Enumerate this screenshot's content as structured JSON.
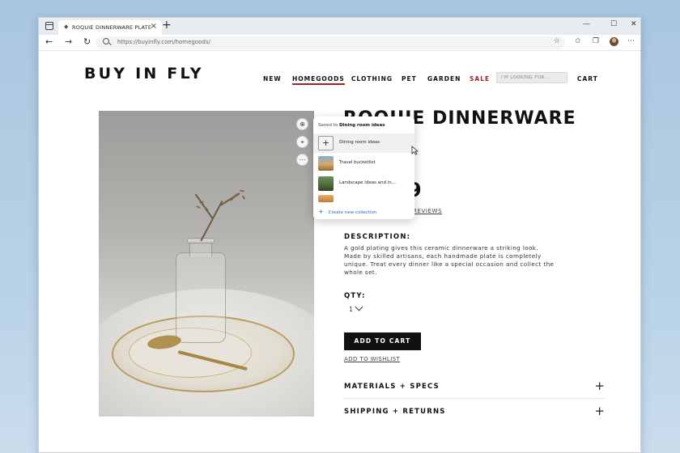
{
  "browser": {
    "tab_title": "ROQUIE DINNERWARE  PLATE",
    "url": "https://buyinfly.com/homegoods/",
    "window_controls": [
      "—",
      "☐",
      "✕"
    ]
  },
  "site": {
    "logo": "BUY IN FLY",
    "nav": [
      "NEW",
      "HOMEGOODS",
      "CLOTHING",
      "PET",
      "GARDEN",
      "SALE"
    ],
    "search_placeholder": "I'M LOOKING FOR...",
    "cart": "CART"
  },
  "collections_popup": {
    "saved_prefix": "Saved to",
    "saved_collection": "Dining room ideas",
    "items": [
      "Dining room ideas",
      "Travel bucketlist",
      "Landscape ideas and in..."
    ],
    "create_label": "Create new collection"
  },
  "product": {
    "title": "ROQUIE DINNERWARE",
    "price_visible": "9",
    "reviews_link": "REVIEWS",
    "description_heading": "DESCRIPTION:",
    "description": "A gold plating gives this ceramic dinnerware a striking look. Made by skilled artisans, each handmade plate is completely unique. Treat every dinner like a special occasion and collect the whole set.",
    "qty_heading": "QTY:",
    "qty_value": "1",
    "add_to_cart": "ADD TO CART",
    "add_to_wishlist": "ADD TO WISHLIST",
    "accordions": [
      "MATERIALS + SPECS",
      "SHIPPING + RETURNS"
    ]
  }
}
